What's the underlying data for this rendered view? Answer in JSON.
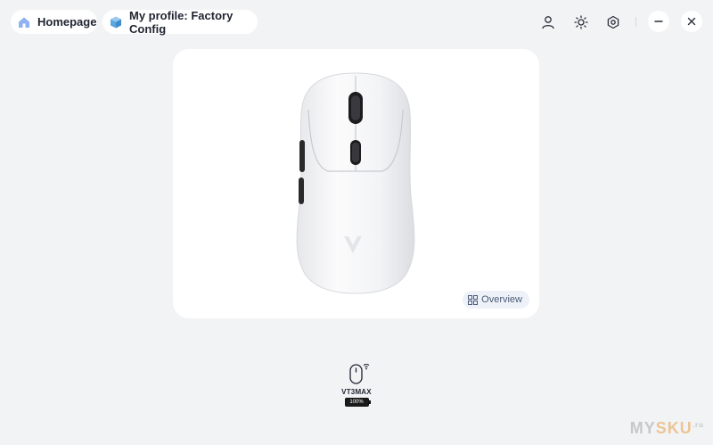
{
  "header": {
    "home_label": "Homepage",
    "profile_label": "My profile: Factory Config",
    "icons": [
      "user-icon",
      "sun-icon",
      "settings-icon",
      "minimize-icon",
      "close-icon"
    ]
  },
  "preview": {
    "overview_label": "Overview"
  },
  "device": {
    "name": "VT3MAX",
    "battery": "100%",
    "battery_level": 1.0
  },
  "watermark": {
    "pre": "MY",
    "mid": "SKU",
    "post": ".ru"
  },
  "colors": {
    "background": "#f2f3f5",
    "card": "#ffffff",
    "home_icon": "#5b8def",
    "profile_icon": "#4fa3d9"
  }
}
